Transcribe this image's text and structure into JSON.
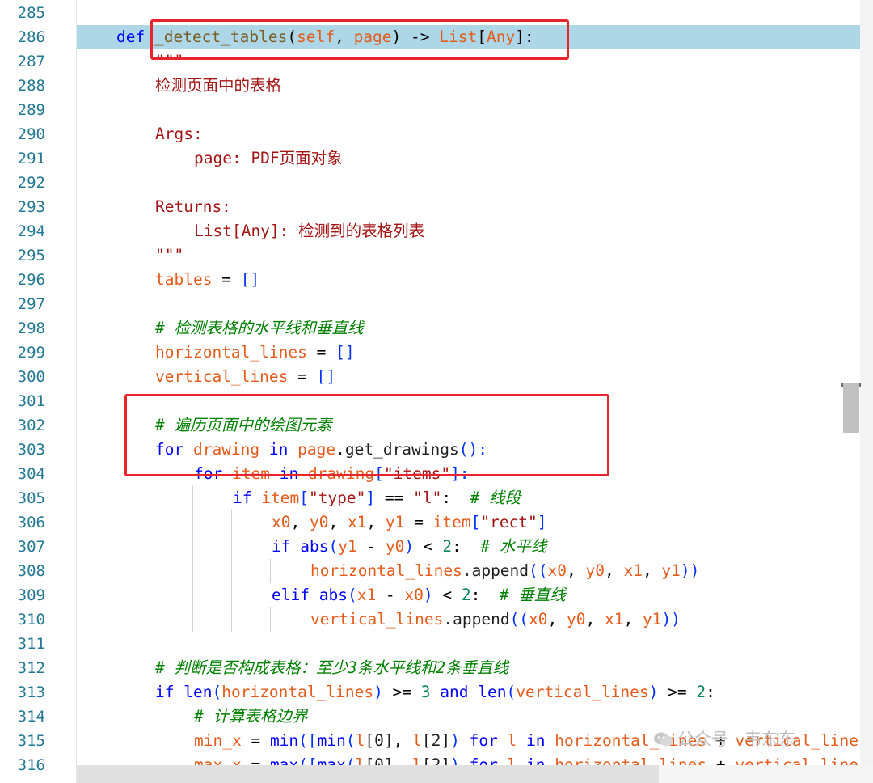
{
  "editor": {
    "highlighted_line": 286,
    "lines": [
      {
        "n": "285",
        "indent": 0,
        "tokens": []
      },
      {
        "n": "286",
        "indent": 1,
        "tokens": [
          [
            "def",
            "tk-def"
          ],
          [
            " ",
            "tk-plain"
          ],
          [
            "_detect_tables",
            "tk-defn"
          ],
          [
            "(",
            "tk-op"
          ],
          [
            "self",
            "tk-self"
          ],
          [
            ", ",
            "tk-op"
          ],
          [
            "page",
            "tk-self"
          ],
          [
            ") -> ",
            "tk-op"
          ],
          [
            "List",
            "tk-type"
          ],
          [
            "[",
            "tk-op"
          ],
          [
            "Any",
            "tk-type"
          ],
          [
            "]:",
            "tk-op"
          ]
        ]
      },
      {
        "n": "287",
        "indent": 2,
        "tokens": [
          [
            "\"\"\"",
            "tk-doc"
          ]
        ]
      },
      {
        "n": "288",
        "indent": 2,
        "tokens": [
          [
            "检测页面中的表格",
            "tk-doc"
          ]
        ]
      },
      {
        "n": "289",
        "indent": 2,
        "tokens": []
      },
      {
        "n": "290",
        "indent": 2,
        "tokens": [
          [
            "Args:",
            "tk-doc"
          ]
        ]
      },
      {
        "n": "291",
        "indent": 3,
        "tokens": [
          [
            "page: PDF页面对象",
            "tk-doc"
          ]
        ]
      },
      {
        "n": "292",
        "indent": 2,
        "tokens": []
      },
      {
        "n": "293",
        "indent": 2,
        "tokens": [
          [
            "Returns:",
            "tk-doc"
          ]
        ]
      },
      {
        "n": "294",
        "indent": 3,
        "tokens": [
          [
            "List[Any]: 检测到的表格列表",
            "tk-doc"
          ]
        ]
      },
      {
        "n": "295",
        "indent": 2,
        "tokens": [
          [
            "\"\"\"",
            "tk-doc"
          ]
        ]
      },
      {
        "n": "296",
        "indent": 2,
        "tokens": [
          [
            "tables",
            "tk-var"
          ],
          [
            " = ",
            "tk-op"
          ],
          [
            "[]",
            "tk-br"
          ]
        ]
      },
      {
        "n": "297",
        "indent": 2,
        "tokens": []
      },
      {
        "n": "298",
        "indent": 2,
        "tokens": [
          [
            "# 检测表格的水平线和垂直线",
            "tk-cm"
          ]
        ]
      },
      {
        "n": "299",
        "indent": 2,
        "tokens": [
          [
            "horizontal_lines",
            "tk-var"
          ],
          [
            " = ",
            "tk-op"
          ],
          [
            "[]",
            "tk-br"
          ]
        ]
      },
      {
        "n": "300",
        "indent": 2,
        "tokens": [
          [
            "vertical_lines",
            "tk-var"
          ],
          [
            " = ",
            "tk-op"
          ],
          [
            "[]",
            "tk-br"
          ]
        ]
      },
      {
        "n": "301",
        "indent": 2,
        "tokens": []
      },
      {
        "n": "302",
        "indent": 2,
        "tokens": [
          [
            "# 遍历页面中的绘图元素",
            "tk-cm"
          ]
        ]
      },
      {
        "n": "303",
        "indent": 2,
        "tokens": [
          [
            "for",
            "tk-kw"
          ],
          [
            " ",
            "tk-plain"
          ],
          [
            "drawing",
            "tk-var"
          ],
          [
            " ",
            "tk-plain"
          ],
          [
            "in",
            "tk-kw"
          ],
          [
            " ",
            "tk-plain"
          ],
          [
            "page",
            "tk-var"
          ],
          [
            ".get_drawings",
            "tk-plain"
          ],
          [
            "():",
            "tk-br"
          ]
        ]
      },
      {
        "n": "304",
        "indent": 3,
        "tokens": [
          [
            "for",
            "tk-kw"
          ],
          [
            " ",
            "tk-plain"
          ],
          [
            "item",
            "tk-var"
          ],
          [
            " ",
            "tk-plain"
          ],
          [
            "in",
            "tk-kw"
          ],
          [
            " ",
            "tk-plain"
          ],
          [
            "drawing",
            "tk-var"
          ],
          [
            "[",
            "tk-br"
          ],
          [
            "\"items\"",
            "tk-str"
          ],
          [
            "]:",
            "tk-br"
          ]
        ]
      },
      {
        "n": "305",
        "indent": 4,
        "tokens": [
          [
            "if",
            "tk-kw"
          ],
          [
            " ",
            "tk-plain"
          ],
          [
            "item",
            "tk-var"
          ],
          [
            "[",
            "tk-br"
          ],
          [
            "\"type\"",
            "tk-str"
          ],
          [
            "]",
            "tk-br"
          ],
          [
            " == ",
            "tk-op"
          ],
          [
            "\"l\"",
            "tk-str"
          ],
          [
            ":  ",
            "tk-op"
          ],
          [
            "# 线段",
            "tk-cm"
          ]
        ]
      },
      {
        "n": "306",
        "indent": 5,
        "tokens": [
          [
            "x0",
            "tk-var"
          ],
          [
            ", ",
            "tk-op"
          ],
          [
            "y0",
            "tk-var"
          ],
          [
            ", ",
            "tk-op"
          ],
          [
            "x1",
            "tk-var"
          ],
          [
            ", ",
            "tk-op"
          ],
          [
            "y1",
            "tk-var"
          ],
          [
            " = ",
            "tk-op"
          ],
          [
            "item",
            "tk-var"
          ],
          [
            "[",
            "tk-br"
          ],
          [
            "\"rect\"",
            "tk-str"
          ],
          [
            "]",
            "tk-br"
          ]
        ]
      },
      {
        "n": "307",
        "indent": 5,
        "tokens": [
          [
            "if",
            "tk-kw"
          ],
          [
            " ",
            "tk-plain"
          ],
          [
            "abs",
            "tk-kw"
          ],
          [
            "(",
            "tk-br"
          ],
          [
            "y1",
            "tk-var"
          ],
          [
            " - ",
            "tk-op"
          ],
          [
            "y0",
            "tk-var"
          ],
          [
            ")",
            "tk-br"
          ],
          [
            " < ",
            "tk-op"
          ],
          [
            "2",
            "tk-num"
          ],
          [
            ":  ",
            "tk-op"
          ],
          [
            "# 水平线",
            "tk-cm"
          ]
        ]
      },
      {
        "n": "308",
        "indent": 6,
        "tokens": [
          [
            "horizontal_lines",
            "tk-var"
          ],
          [
            ".append",
            "tk-plain"
          ],
          [
            "((",
            "tk-br"
          ],
          [
            "x0",
            "tk-var"
          ],
          [
            ", ",
            "tk-op"
          ],
          [
            "y0",
            "tk-var"
          ],
          [
            ", ",
            "tk-op"
          ],
          [
            "x1",
            "tk-var"
          ],
          [
            ", ",
            "tk-op"
          ],
          [
            "y1",
            "tk-var"
          ],
          [
            "))",
            "tk-br"
          ]
        ]
      },
      {
        "n": "309",
        "indent": 5,
        "tokens": [
          [
            "elif",
            "tk-kw"
          ],
          [
            " ",
            "tk-plain"
          ],
          [
            "abs",
            "tk-kw"
          ],
          [
            "(",
            "tk-br"
          ],
          [
            "x1",
            "tk-var"
          ],
          [
            " - ",
            "tk-op"
          ],
          [
            "x0",
            "tk-var"
          ],
          [
            ")",
            "tk-br"
          ],
          [
            " < ",
            "tk-op"
          ],
          [
            "2",
            "tk-num"
          ],
          [
            ":  ",
            "tk-op"
          ],
          [
            "# 垂直线",
            "tk-cm"
          ]
        ]
      },
      {
        "n": "310",
        "indent": 6,
        "tokens": [
          [
            "vertical_lines",
            "tk-var"
          ],
          [
            ".append",
            "tk-plain"
          ],
          [
            "((",
            "tk-br"
          ],
          [
            "x0",
            "tk-var"
          ],
          [
            ", ",
            "tk-op"
          ],
          [
            "y0",
            "tk-var"
          ],
          [
            ", ",
            "tk-op"
          ],
          [
            "x1",
            "tk-var"
          ],
          [
            ", ",
            "tk-op"
          ],
          [
            "y1",
            "tk-var"
          ],
          [
            "))",
            "tk-br"
          ]
        ]
      },
      {
        "n": "311",
        "indent": 2,
        "tokens": []
      },
      {
        "n": "312",
        "indent": 2,
        "tokens": [
          [
            "# 判断是否构成表格：至少3条水平线和2条垂直线",
            "tk-cm"
          ]
        ]
      },
      {
        "n": "313",
        "indent": 2,
        "tokens": [
          [
            "if",
            "tk-kw"
          ],
          [
            " ",
            "tk-plain"
          ],
          [
            "len",
            "tk-kw"
          ],
          [
            "(",
            "tk-br"
          ],
          [
            "horizontal_lines",
            "tk-var"
          ],
          [
            ")",
            "tk-br"
          ],
          [
            " >= ",
            "tk-op"
          ],
          [
            "3",
            "tk-num"
          ],
          [
            " and ",
            "tk-kw"
          ],
          [
            "len",
            "tk-kw"
          ],
          [
            "(",
            "tk-br"
          ],
          [
            "vertical_lines",
            "tk-var"
          ],
          [
            ")",
            "tk-br"
          ],
          [
            " >= ",
            "tk-op"
          ],
          [
            "2",
            "tk-num"
          ],
          [
            ":",
            "tk-op"
          ]
        ]
      },
      {
        "n": "314",
        "indent": 3,
        "tokens": [
          [
            "# 计算表格边界",
            "tk-cm"
          ]
        ]
      },
      {
        "n": "315",
        "indent": 3,
        "tokens": [
          [
            "min_x",
            "tk-var"
          ],
          [
            " = ",
            "tk-op"
          ],
          [
            "min",
            "tk-kw"
          ],
          [
            "([",
            "tk-br"
          ],
          [
            "min",
            "tk-kw"
          ],
          [
            "(",
            "tk-br"
          ],
          [
            "l",
            "tk-var"
          ],
          [
            "[0]",
            "tk-plain"
          ],
          [
            ", ",
            "tk-op"
          ],
          [
            "l",
            "tk-var"
          ],
          [
            "[2]",
            "tk-plain"
          ],
          [
            ")",
            "tk-br"
          ],
          [
            " for ",
            "tk-kw"
          ],
          [
            "l",
            "tk-var"
          ],
          [
            " in ",
            "tk-kw"
          ],
          [
            "horizontal_lines",
            "tk-var"
          ],
          [
            " + ",
            "tk-op"
          ],
          [
            "vertical_lines",
            "tk-var"
          ]
        ]
      },
      {
        "n": "316",
        "indent": 3,
        "tokens": [
          [
            "max_x",
            "tk-var"
          ],
          [
            " = ",
            "tk-op"
          ],
          [
            "max",
            "tk-kw"
          ],
          [
            "([",
            "tk-br"
          ],
          [
            "max",
            "tk-kw"
          ],
          [
            "(",
            "tk-br"
          ],
          [
            "l",
            "tk-var"
          ],
          [
            "[0]",
            "tk-plain"
          ],
          [
            ", ",
            "tk-op"
          ],
          [
            "l",
            "tk-var"
          ],
          [
            "[2]",
            "tk-plain"
          ],
          [
            ")",
            "tk-br"
          ],
          [
            " for ",
            "tk-kw"
          ],
          [
            "l",
            "tk-var"
          ],
          [
            " in ",
            "tk-kw"
          ],
          [
            "horizontal_lines",
            "tk-var"
          ],
          [
            " + ",
            "tk-op"
          ],
          [
            "vertical_lines",
            "tk-var"
          ]
        ]
      }
    ]
  },
  "watermark": {
    "text": "公众号 · 韦东东"
  },
  "colors": {
    "highlight": "#add6e6",
    "annotation": "#e8242c",
    "line_number": "#237893"
  }
}
